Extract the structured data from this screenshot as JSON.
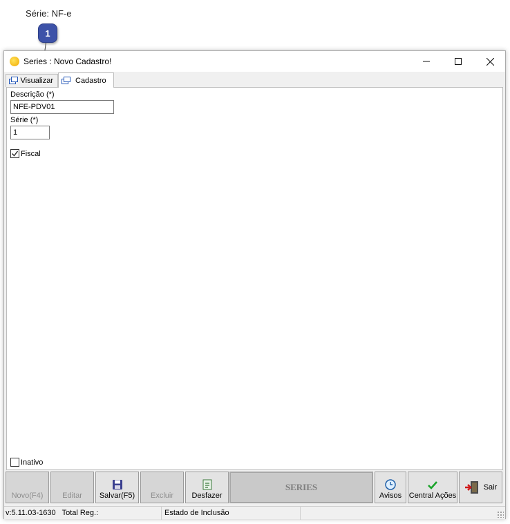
{
  "doc": {
    "caption": "Série: NF-e",
    "callout_number": "1"
  },
  "window": {
    "title": "Series : Novo Cadastro!",
    "icon": "sun-icon"
  },
  "tabs": [
    {
      "label": "Visualizar",
      "icon": "window-icon",
      "active": false
    },
    {
      "label": "Cadastro",
      "icon": "window-icon",
      "active": true
    }
  ],
  "form": {
    "descricao_label": "Descrição (*)",
    "descricao_value": "NFE-PDV01",
    "serie_label": "Série (*)",
    "serie_value": "1",
    "fiscal_label": "Fiscal",
    "fiscal_checked": true,
    "inativo_label": "Inativo",
    "inativo_checked": false
  },
  "toolbar": {
    "novo": "Novo(F4)",
    "editar": "Editar",
    "salvar": "Salvar(F5)",
    "excluir": "Excluir",
    "desfazer": "Desfazer",
    "banner": "SERIES",
    "avisos": "Avisos",
    "central": "Central Ações",
    "sair": "Sair"
  },
  "status": {
    "version": "v:5.11.03-1630",
    "total": "Total Reg.:",
    "estado": "Estado de Inclusão"
  },
  "colors": {
    "callout": "#3d52a8",
    "accent_blue": "#2457b8",
    "check_green": "#1aa32a"
  }
}
